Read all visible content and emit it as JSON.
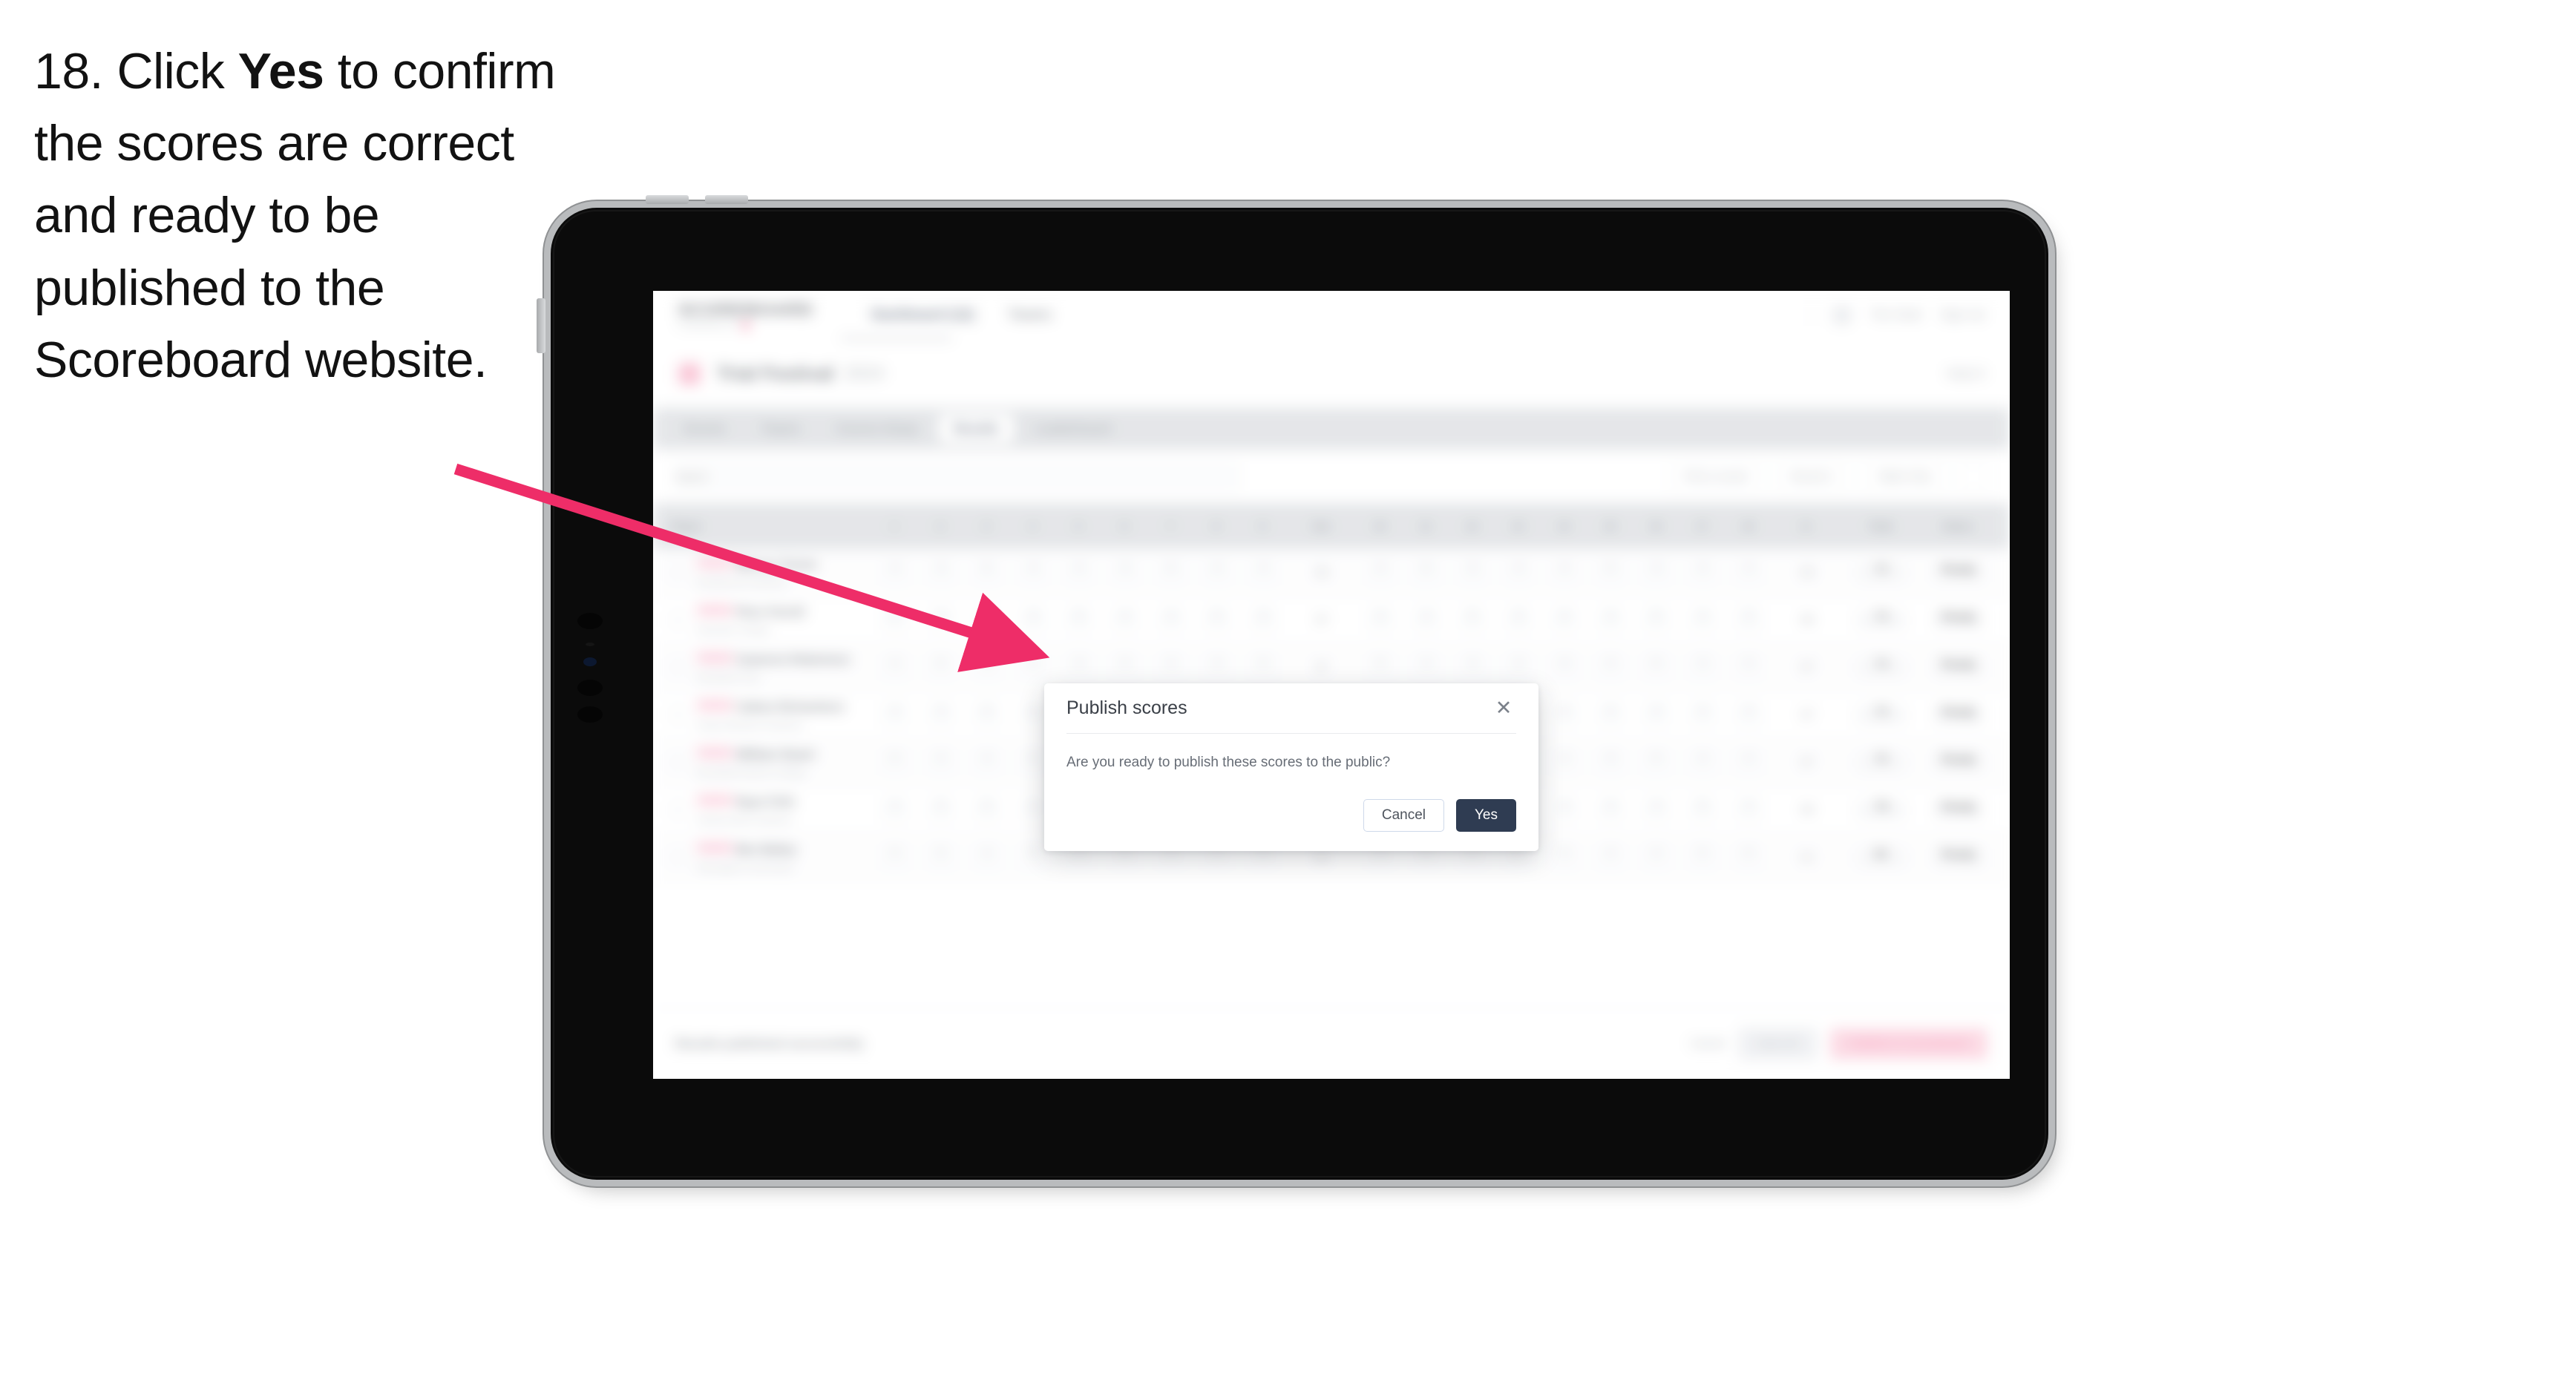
{
  "caption": {
    "number": "18.",
    "text_before": "Click ",
    "emphasis": "Yes",
    "text_after": " to confirm the scores are correct and ready to be published to the Scoreboard website."
  },
  "annotation": {
    "arrow_color": "#ee2d68",
    "points_to": "yes-button"
  },
  "device": {
    "type": "tablet",
    "bezel_color": "#0b0b0b",
    "frame_color": "#b9bbbd"
  },
  "app": {
    "topbar": {
      "brand_name": "SCOREBOARD",
      "brand_sub": "POWERED BY",
      "nav": [
        "Dashboard (12)",
        "Teams"
      ],
      "right": [
        "Tim Clark",
        "Sign out"
      ]
    },
    "event": {
      "title": "Trial Festival",
      "subtitle": "2024",
      "right": "Heat 3"
    },
    "tabs": [
      {
        "label": "Events",
        "selected": false
      },
      {
        "label": "Teams",
        "selected": false
      },
      {
        "label": "Course Setup",
        "selected": false
      },
      {
        "label": "Results",
        "selected": true
      },
      {
        "label": "Leaderboard",
        "selected": false
      }
    ],
    "filters": {
      "search_placeholder": "Search",
      "chips": [
        "Pick a round",
        "Round 1",
        "Table Only"
      ]
    },
    "table": {
      "columns": [
        "Player",
        "1",
        "2",
        "3",
        "4",
        "5",
        "6",
        "7",
        "8",
        "9",
        "Out",
        "10",
        "11",
        "12",
        "13",
        "14",
        "15",
        "16",
        "17",
        "18",
        "In",
        "Total",
        "Status"
      ],
      "rows": [
        {
          "tag": "GBR",
          "name": "Marcus Turner",
          "team": "Northbrook Academy",
          "scores": [
            "4",
            "3",
            "5",
            "4",
            "4",
            "3",
            "5",
            "4",
            "4"
          ],
          "out": "36",
          "scores_in": [
            "4",
            "5",
            "3",
            "4",
            "4",
            "5",
            "3",
            "4",
            "4"
          ],
          "in": "36",
          "total": "72",
          "status": "Ready"
        },
        {
          "tag": "GBR",
          "name": "Piers Farrell",
          "team": "Eastvale College",
          "scores": [
            "5",
            "4",
            "4",
            "3",
            "5",
            "4",
            "4",
            "5",
            "3"
          ],
          "out": "37",
          "scores_in": [
            "4",
            "4",
            "5",
            "3",
            "4",
            "4",
            "5",
            "4",
            "3"
          ],
          "in": "36",
          "total": "73",
          "status": "Ready"
        },
        {
          "tag": "GBR",
          "name": "Cameron Robertson",
          "team": "Westfield Club",
          "scores": [
            "4",
            "5",
            "4",
            "4",
            "3",
            "5",
            "4",
            "3",
            "5"
          ],
          "out": "37",
          "scores_in": [
            "5",
            "4",
            "4",
            "4",
            "3",
            "4",
            "5",
            "4",
            "4"
          ],
          "in": "37",
          "total": "74",
          "status": "Ready"
        },
        {
          "tag": "GBR",
          "name": "Callum Richardson",
          "team": "Kings Meadow Academy",
          "scores": [
            "4",
            "4",
            "5",
            "4",
            "4",
            "4",
            "3",
            "5",
            "4"
          ],
          "out": "37",
          "scores_in": [
            "4",
            "3",
            "5",
            "4",
            "5",
            "4",
            "4",
            "4",
            "4"
          ],
          "in": "37",
          "total": "74",
          "status": "Ready"
        },
        {
          "tag": "GBR",
          "name": "William Stuart",
          "team": "Brookfield Sports College",
          "scores": [
            "5",
            "4",
            "4",
            "5",
            "4",
            "3",
            "4",
            "4",
            "5"
          ],
          "out": "38",
          "scores_in": [
            "4",
            "5",
            "4",
            "4",
            "4",
            "3",
            "5",
            "4",
            "4"
          ],
          "in": "37",
          "total": "75",
          "status": "Ready"
        },
        {
          "tag": "GBR",
          "name": "Ryan Firth",
          "team": "Harbourside Academy",
          "scores": [
            "4",
            "5",
            "5",
            "4",
            "4",
            "4",
            "5",
            "4",
            "4"
          ],
          "out": "39",
          "scores_in": [
            "5",
            "4",
            "4",
            "5",
            "4",
            "4",
            "4",
            "5",
            "4"
          ],
          "in": "39",
          "total": "78",
          "status": "Ready"
        },
        {
          "tag": "GBR",
          "name": "Ben Bailey",
          "team": "Stonegate Community",
          "scores": [
            "5",
            "5",
            "4",
            "5",
            "4",
            "5",
            "4",
            "4",
            "5"
          ],
          "out": "41",
          "scores_in": [
            "4",
            "5",
            "5",
            "4",
            "5",
            "4",
            "4",
            "5",
            "5"
          ],
          "in": "41",
          "total": "82",
          "status": "Ready"
        }
      ]
    },
    "bottom_bar": {
      "note": "Results published successfully",
      "ghost": "Cancel",
      "secondary": "Save all",
      "primary": "Publish to Scoreboard"
    }
  },
  "modal": {
    "title": "Publish scores",
    "close_icon": "close-icon",
    "body": "Are you ready to publish these scores to the public?",
    "cancel_label": "Cancel",
    "confirm_label": "Yes",
    "confirm_color": "#2f3c52"
  }
}
